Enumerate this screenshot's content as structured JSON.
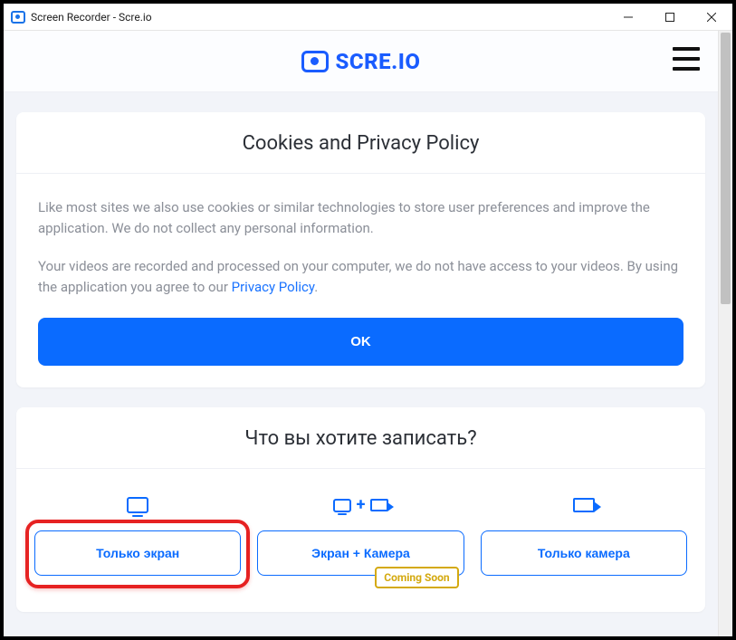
{
  "window": {
    "title": "Screen Recorder - Scre.io"
  },
  "header": {
    "brand": "SCRE.IO"
  },
  "cookies": {
    "title": "Cookies and Privacy Policy",
    "p1": "Like most sites we also use cookies or similar technologies to store user preferences and improve the application. We do not collect any personal information.",
    "p2_a": "Your videos are recorded and processed on your computer, we do not have access to your videos. By using the application you agree to our ",
    "p2_link": "Privacy Policy",
    "p2_b": ".",
    "ok": "OK"
  },
  "record": {
    "title": "Что вы хотите записать?",
    "opt1": "Только экран",
    "opt2": "Экран + Камера",
    "opt2_badge": "Coming Soon",
    "opt3": "Только камера"
  }
}
